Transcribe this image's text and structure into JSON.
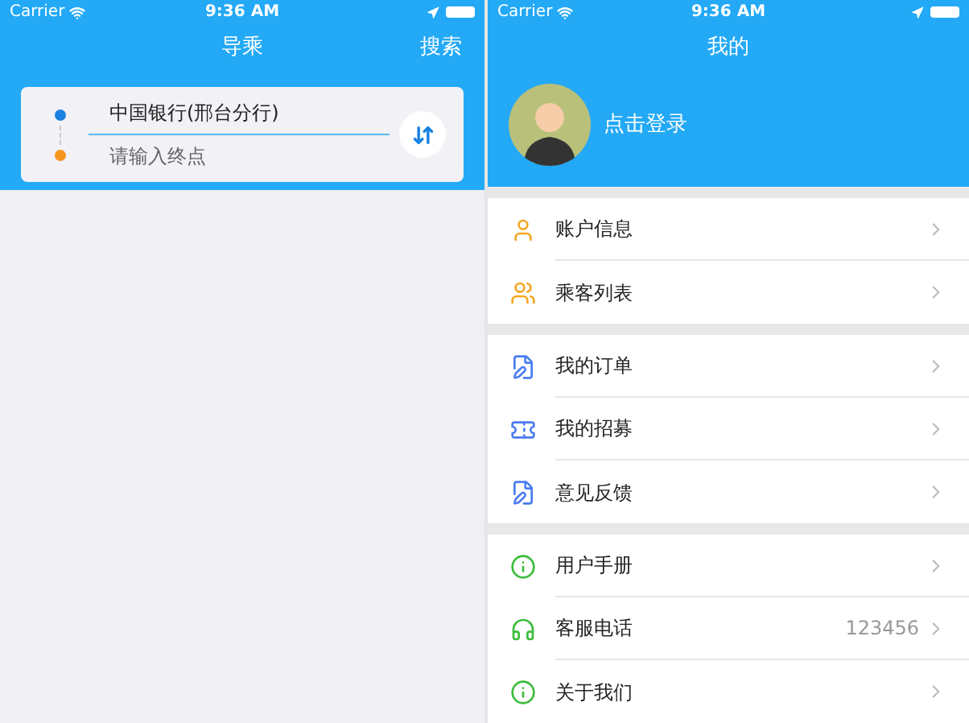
{
  "left_screen": {
    "status_bar": {
      "carrier": "Carrier",
      "time": "9:36 AM"
    },
    "nav_bar": {
      "title": "导乘",
      "action": "搜索"
    },
    "route": {
      "start": "中国银行(邢台分行)",
      "end_placeholder": "请输入终点"
    }
  },
  "right_screen": {
    "status_bar": {
      "carrier": "Carrier",
      "time": "9:36 AM"
    },
    "nav_bar": {
      "title": "我的"
    },
    "profile": {
      "login": "点击登录"
    },
    "menu_groups": [
      {
        "items": [
          {
            "label": "账户信息"
          },
          {
            "label": "乘客列表"
          }
        ]
      },
      {
        "items": [
          {
            "label": "我的订单"
          },
          {
            "label": "我的招募"
          },
          {
            "label": "意见反馈"
          }
        ]
      },
      {
        "items": [
          {
            "label": "用户手册"
          },
          {
            "label": "客服电话",
            "value": "123456"
          },
          {
            "label": "关于我们"
          }
        ]
      }
    ]
  }
}
